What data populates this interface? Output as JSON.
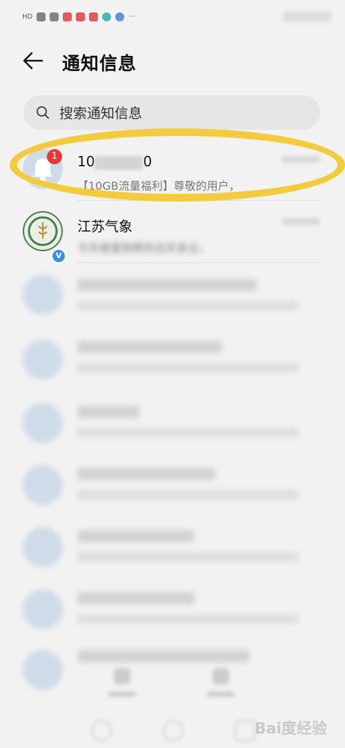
{
  "status_bar": {
    "network_label": "HD",
    "more_dots": "···"
  },
  "header": {
    "title": "通知信息"
  },
  "search": {
    "placeholder": "搜索通知信息"
  },
  "messages": [
    {
      "name_visible_start": "10",
      "name_visible_end": "0",
      "preview": "【10GB流量福利】尊敬的用户，",
      "unread": "1",
      "highlighted": true
    },
    {
      "name": "江苏气象",
      "preview": "今天夜里到明天白天多云，",
      "verified": true
    }
  ],
  "blurred_rows": 7,
  "watermark": "Bai度经验",
  "colors": {
    "highlight": "#f3cb3c",
    "badge": "#e53935",
    "verified": "#3a8ee6",
    "avatar": "#cfdbe8"
  }
}
